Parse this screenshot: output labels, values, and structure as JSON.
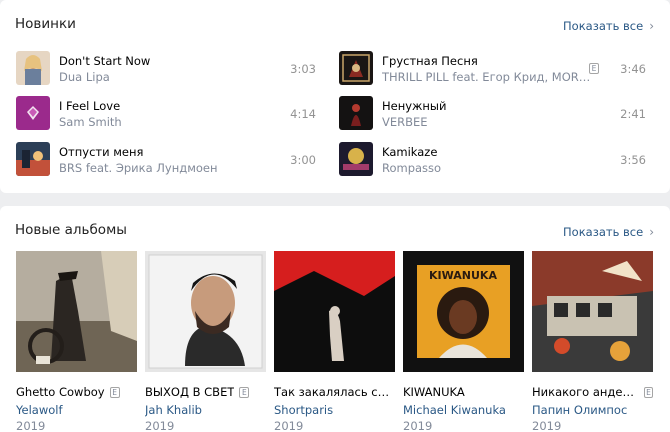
{
  "new_tracks": {
    "title": "Новинки",
    "show_all": "Показать все",
    "tracks": [
      {
        "title": "Don't Start Now",
        "artist": "Dua Lipa",
        "duration": "3:03",
        "explicit": false,
        "icon": "album-cover-icon"
      },
      {
        "title": "I Feel Love",
        "artist": "Sam Smith",
        "duration": "4:14",
        "explicit": false,
        "icon": "album-cover-icon"
      },
      {
        "title": "Отпусти меня",
        "artist": "BRS feat. Эрика Лундмоен",
        "duration": "3:00",
        "explicit": false,
        "icon": "album-cover-icon"
      },
      {
        "title": "Грустная Песня",
        "artist": "THRILL PILL feat. Егор Крид, MORGENSH...",
        "duration": "3:46",
        "explicit": true,
        "icon": "album-cover-icon"
      },
      {
        "title": "Ненужный",
        "artist": "VERBEE",
        "duration": "2:41",
        "explicit": false,
        "icon": "album-cover-icon"
      },
      {
        "title": "Kamikaze",
        "artist": "Rompasso",
        "duration": "3:56",
        "explicit": false,
        "icon": "album-cover-icon"
      }
    ]
  },
  "new_albums": {
    "title": "Новые альбомы",
    "show_all": "Показать все",
    "albums": [
      {
        "name": "Ghetto Cowboy",
        "artist": "Yelawolf",
        "year": "2019",
        "explicit": true
      },
      {
        "name": "ВЫХОД В СВЕТ",
        "artist": "Jah Khalib",
        "year": "2019",
        "explicit": true
      },
      {
        "name": "Так закалялась ст...",
        "artist": "Shortparis",
        "year": "2019",
        "explicit": false
      },
      {
        "name": "KIWANUKA",
        "artist": "Michael Kiwanuka",
        "year": "2019",
        "explicit": false
      },
      {
        "name": "Никакого андегра...",
        "artist": "Папин Олимпос",
        "year": "2019",
        "explicit": true
      }
    ]
  },
  "explicit_mark": "E",
  "cover_art_text": {
    "kiwanuka": "KIWANUKA"
  },
  "colors": {
    "link": "#2a5885",
    "secondary_text": "#828a99",
    "background": "#edeef0",
    "card": "#ffffff"
  }
}
